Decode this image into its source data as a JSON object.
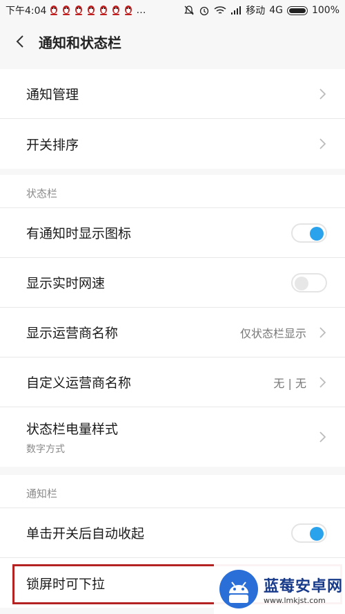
{
  "status_bar": {
    "time": "下午4:04",
    "carrier": "移动",
    "network": "4G",
    "battery": "100%"
  },
  "header": {
    "title": "通知和状态栏",
    "back_icon": "chevron-left-icon"
  },
  "section1": {
    "items": [
      {
        "label": "通知管理"
      },
      {
        "label": "开关排序"
      }
    ]
  },
  "statusbar_section": {
    "heading": "状态栏",
    "items": [
      {
        "label": "有通知时显示图标",
        "toggle": "on"
      },
      {
        "label": "显示实时网速",
        "toggle": "off"
      },
      {
        "label": "显示运营商名称",
        "value": "仅状态栏显示"
      },
      {
        "label": "自定义运营商名称",
        "value": "无 | 无"
      },
      {
        "label": "状态栏电量样式",
        "sublabel": "数字方式"
      }
    ]
  },
  "notification_section": {
    "heading": "通知栏",
    "items": [
      {
        "label": "单击开关后自动收起",
        "toggle": "on"
      },
      {
        "label": "锁屏时可下拉",
        "toggle": "off"
      }
    ]
  },
  "watermark": {
    "title": "蓝莓安卓网",
    "url": "www.lmkjst.com"
  },
  "colors": {
    "accent": "#2aa2ec",
    "highlight": "#b42222"
  }
}
